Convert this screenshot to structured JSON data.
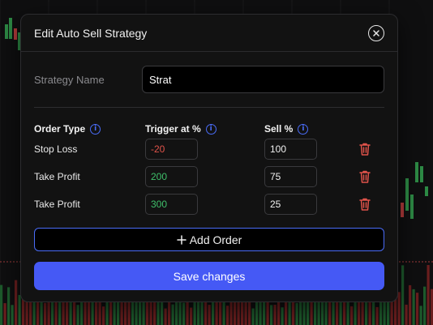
{
  "modal": {
    "title": "Edit Auto Sell Strategy",
    "strategy_name_label": "Strategy Name",
    "strategy_name_value": "Strat",
    "columns": {
      "order_type": "Order Type",
      "trigger": "Trigger at %",
      "sell": "Sell %"
    },
    "orders": [
      {
        "type": "Stop Loss",
        "trigger": "-20",
        "sell": "100"
      },
      {
        "type": "Take Profit",
        "trigger": "200",
        "sell": "75"
      },
      {
        "type": "Take Profit",
        "trigger": "300",
        "sell": "25"
      }
    ],
    "add_order_label": "Add Order",
    "save_label": "Save changes"
  },
  "colors": {
    "accent": "#4559f5",
    "negative": "#e0534a",
    "positive": "#3fbf6a",
    "danger_icon": "#e0534a"
  },
  "icons": {
    "close": "close-icon",
    "info": "info-icon",
    "delete": "trash-icon",
    "add": "plus-icon"
  }
}
